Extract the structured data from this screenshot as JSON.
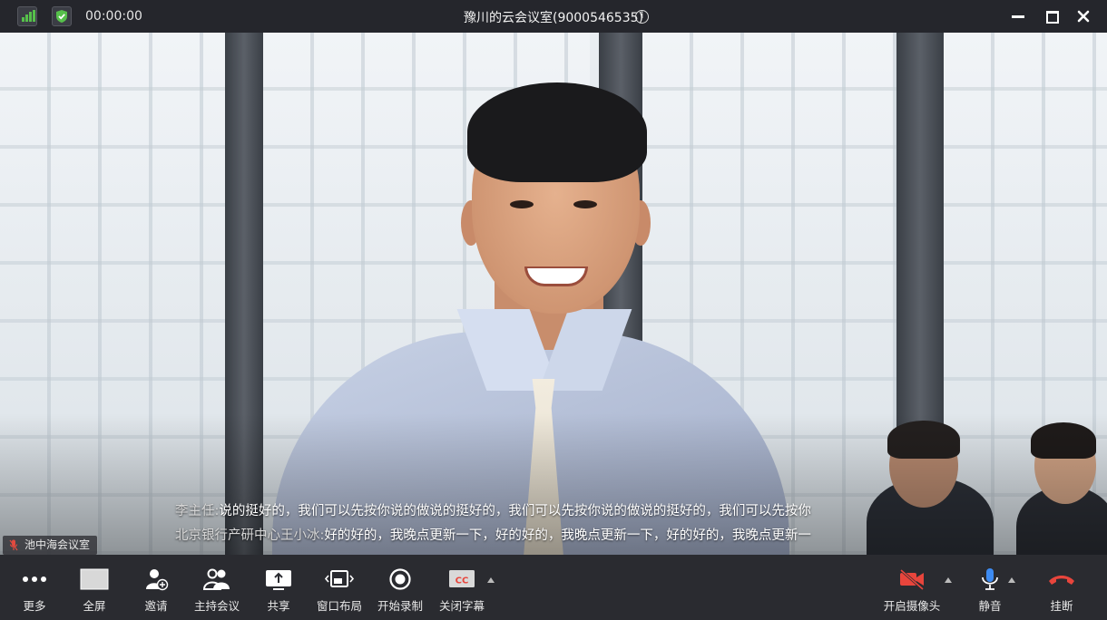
{
  "titlebar": {
    "timer": "00:00:00",
    "title": "豫川的云会议室(9000546535)",
    "info_glyph": "i",
    "icons": {
      "signal": "signal-strength-icon",
      "security": "shield-check-icon",
      "info": "info-icon"
    }
  },
  "video": {
    "room_tag": "池中海会议室",
    "subtitles": [
      {
        "speaker": "李主任:",
        "text": "说的挺好的，我们可以先按你说的做说的挺好的，我们可以先按你说的做说的挺好的，我们可以先按你"
      },
      {
        "speaker": "北京银行产研中心王小冰:",
        "text": "好的好的，我晚点更新一下，好的好的，我晚点更新一下，好的好的，我晚点更新一"
      }
    ]
  },
  "toolbar": {
    "left": [
      {
        "label": "更多",
        "icon": "more-dots-icon"
      },
      {
        "label": "全屏",
        "icon": "fullscreen-icon"
      },
      {
        "label": "邀请",
        "icon": "invite-user-icon"
      },
      {
        "label": "主持会议",
        "icon": "host-meeting-icon"
      },
      {
        "label": "共享",
        "icon": "share-screen-icon"
      },
      {
        "label": "窗口布局",
        "icon": "window-layout-icon"
      },
      {
        "label": "开始录制",
        "icon": "record-icon"
      },
      {
        "label": "关闭字幕",
        "icon": "cc-icon",
        "cc_text": "CC"
      }
    ],
    "right": [
      {
        "label": "开启摄像头",
        "icon": "camera-off-icon"
      },
      {
        "label": "静音",
        "icon": "microphone-icon"
      },
      {
        "label": "挂断",
        "icon": "hang-up-icon"
      }
    ]
  },
  "colors": {
    "accent_red": "#e8453c",
    "accent_blue": "#3d8bf2",
    "signal_green": "#56c04b",
    "toolbar_bg": "#2a2b30",
    "titlebar_bg": "#25262c"
  }
}
